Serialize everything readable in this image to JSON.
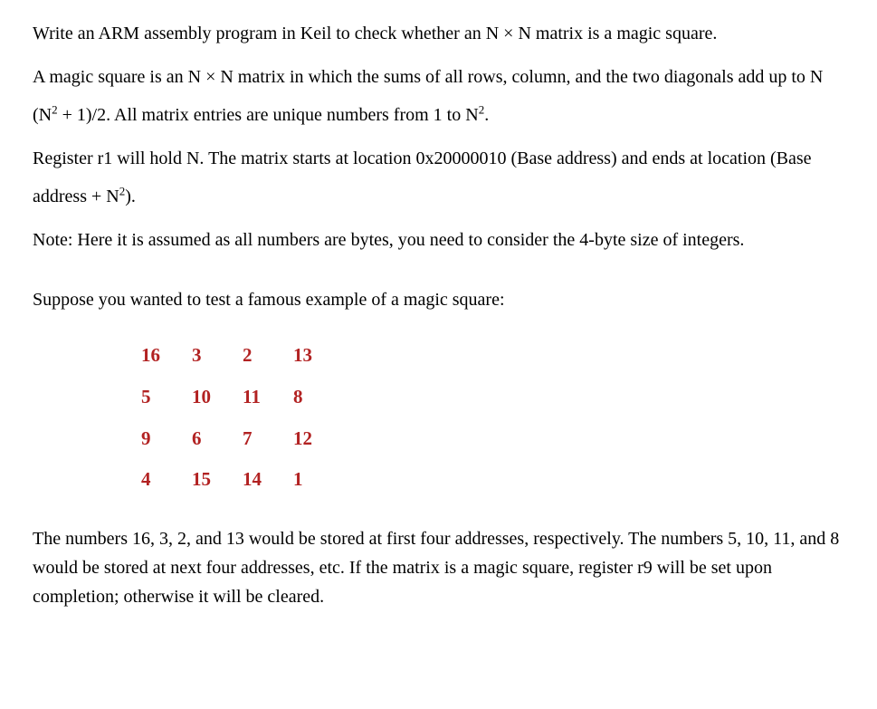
{
  "para1": "Write an ARM assembly program in Keil to check whether an N × N matrix is a magic square.",
  "para2_a": "A magic square is an N × N matrix in which the sums of all rows, column, and the two diagonals add up to N (N",
  "para2_sup1": "2",
  "para2_b": " + 1)/2. All matrix entries are unique numbers from 1 to N",
  "para2_sup2": "2",
  "para2_c": ".",
  "para3_a": "Register r1 will hold N. The matrix starts at location 0x20000010 (Base address) and ends at location (Base address + N",
  "para3_sup": "2",
  "para3_b": ").",
  "para4": "Note: Here it is assumed as all numbers are bytes, you need to consider the 4-byte size of integers.",
  "para5": "Suppose you wanted to test a famous example of a magic square:",
  "matrix": [
    [
      "16",
      "3",
      "2",
      "13"
    ],
    [
      "5",
      "10",
      "11",
      "8"
    ],
    [
      "9",
      "6",
      "7",
      "12"
    ],
    [
      "4",
      "15",
      "14",
      "1"
    ]
  ],
  "para6": "The numbers 16, 3, 2, and 13 would be stored at first four addresses, respectively. The numbers 5, 10, 11, and 8 would be stored at next four addresses, etc. If the matrix is a magic square, register r9 will be set upon completion; otherwise it will be cleared."
}
